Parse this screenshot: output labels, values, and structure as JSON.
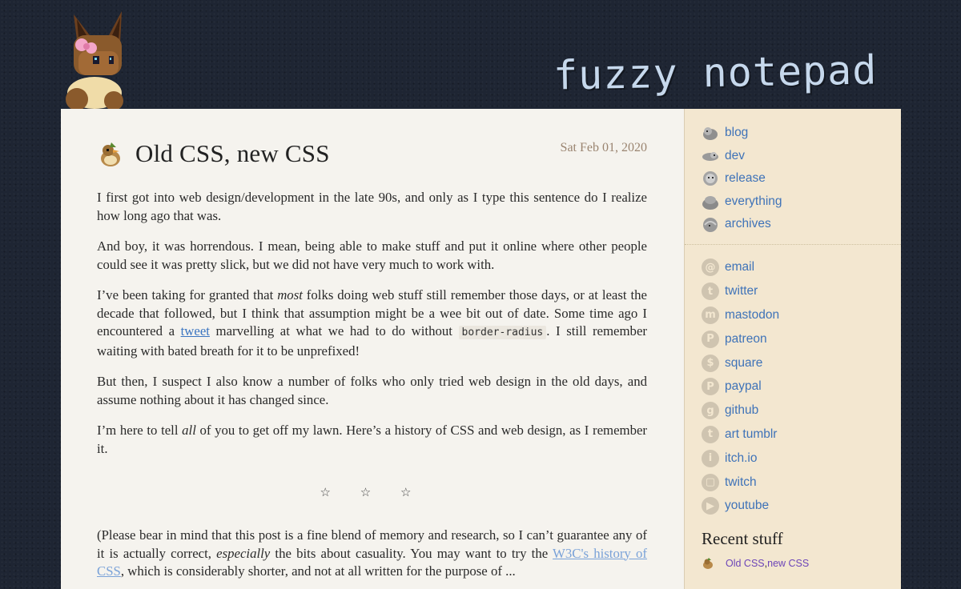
{
  "site": {
    "title": "fuzzy notepad"
  },
  "post": {
    "title": "Old CSS, new CSS",
    "date": "Sat Feb 01, 2020",
    "p1": "I first got into web design/development in the late 90s, and only as I type this sentence do I realize how long ago that was.",
    "p2": "And boy, it was horrendous. I mean, being able to make stuff and put it online where other people could see it was pretty slick, but we did not have very much to work with.",
    "p3_a": "I’ve been taking for granted that ",
    "p3_em": "most",
    "p3_b": " folks doing web stuff still remember those days, or at least the decade that followed, but I think that assumption might be a wee bit out of date. Some time ago I encountered a ",
    "p3_link": "tweet",
    "p3_c": " marvelling at what we had to do without ",
    "p3_code": "border-radius",
    "p3_d": ". I still remember waiting with bated breath for it to be unprefixed!",
    "p4": "But then, I suspect I also know a number of folks who only tried web design in the old days, and assume nothing about it has changed since.",
    "p5_a": "I’m here to tell ",
    "p5_em": "all",
    "p5_b": " of you to get off my lawn. Here’s a history of CSS and web design, as I remember it.",
    "stars": "☆ ☆ ☆",
    "p6_a": "(Please bear in mind that this post is a fine blend of memory and research, so I can’t guarantee any of it is actually correct, ",
    "p6_em": "especially",
    "p6_b": " the bits about casuality. You may want to try the ",
    "p6_link": "W3C's history of CSS",
    "p6_c": ", which is considerably shorter, and not at all written for the purpose of ..."
  },
  "sidebar": {
    "nav": [
      {
        "label": "blog",
        "icon": "pokemon-sprite-icon"
      },
      {
        "label": "dev",
        "icon": "pokemon-sprite-icon"
      },
      {
        "label": "release",
        "icon": "pokemon-sprite-icon"
      },
      {
        "label": "everything",
        "icon": "pokemon-sprite-icon"
      },
      {
        "label": "archives",
        "icon": "pokemon-sprite-icon"
      }
    ],
    "social": [
      {
        "label": "email",
        "glyph": "@"
      },
      {
        "label": "twitter",
        "glyph": "t"
      },
      {
        "label": "mastodon",
        "glyph": "m"
      },
      {
        "label": "patreon",
        "glyph": "P"
      },
      {
        "label": "square",
        "glyph": "$"
      },
      {
        "label": "paypal",
        "glyph": "P"
      },
      {
        "label": "github",
        "glyph": "g"
      },
      {
        "label": "art tumblr",
        "glyph": "t"
      },
      {
        "label": "itch.io",
        "glyph": "i"
      },
      {
        "label": "twitch",
        "glyph": "▢"
      },
      {
        "label": "youtube",
        "glyph": "▶"
      }
    ],
    "recent_title": "Recent stuff",
    "recent_item_a": "Old CSS",
    "recent_item_sep": ", ",
    "recent_item_b": "new CSS"
  },
  "colors": {
    "background": "#1e2533",
    "content_bg": "#f5f3ee",
    "sidebar_bg": "#f3e7d0",
    "link": "#3f73b8",
    "title_text": "#c6d8ec"
  }
}
